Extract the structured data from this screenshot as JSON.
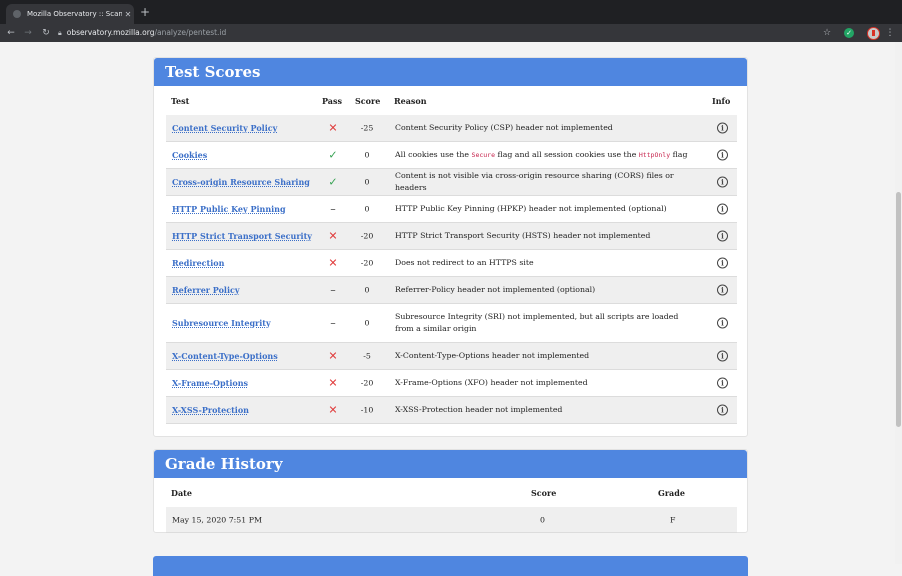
{
  "browser": {
    "tab_title": "Mozilla Observatory :: Scan Re",
    "tab_close": "✕",
    "new_tab": "+",
    "url_host": "observatory.mozilla.org",
    "url_path": "/analyze/pentest.id"
  },
  "test_scores": {
    "title": "Test Scores",
    "headers": {
      "test": "Test",
      "pass": "Pass",
      "score": "Score",
      "reason": "Reason",
      "info": "Info"
    },
    "rows": [
      {
        "name": "Content Security Policy",
        "pass": "fail",
        "score": "-25",
        "reason": "Content Security Policy (CSP) header not implemented"
      },
      {
        "name": "Cookies",
        "pass": "ok",
        "score": "0",
        "reason_parts": [
          "All cookies use the ",
          "Secure",
          " flag and all session cookies use the ",
          "HttpOnly",
          " flag"
        ]
      },
      {
        "name": "Cross-origin Resource Sharing",
        "pass": "ok",
        "score": "0",
        "reason": "Content is not visible via cross-origin resource sharing (CORS) files or headers"
      },
      {
        "name": "HTTP Public Key Pinning",
        "pass": "na",
        "score": "0",
        "reason": "HTTP Public Key Pinning (HPKP) header not implemented (optional)"
      },
      {
        "name": "HTTP Strict Transport Security",
        "pass": "fail",
        "score": "-20",
        "reason": "HTTP Strict Transport Security (HSTS) header not implemented"
      },
      {
        "name": "Redirection",
        "pass": "fail",
        "score": "-20",
        "reason": "Does not redirect to an HTTPS site"
      },
      {
        "name": "Referrer Policy",
        "pass": "na",
        "score": "0",
        "reason": "Referrer-Policy header not implemented (optional)"
      },
      {
        "name": "Subresource Integrity",
        "pass": "na",
        "score": "0",
        "reason": "Subresource Integrity (SRI) not implemented, but all scripts are loaded from a similar origin"
      },
      {
        "name": "X-Content-Type-Options",
        "pass": "fail",
        "score": "-5",
        "reason": "X-Content-Type-Options header not implemented"
      },
      {
        "name": "X-Frame-Options",
        "pass": "fail",
        "score": "-20",
        "reason": "X-Frame-Options (XFO) header not implemented"
      },
      {
        "name": "X-XSS-Protection",
        "pass": "fail",
        "score": "-10",
        "reason": "X-XSS-Protection header not implemented"
      }
    ]
  },
  "grade_history": {
    "title": "Grade History",
    "headers": {
      "date": "Date",
      "score": "Score",
      "grade": "Grade"
    },
    "rows": [
      {
        "date": "May 15, 2020 7:51 PM",
        "score": "0",
        "grade": "F"
      }
    ]
  },
  "icons": {
    "fail": "✕",
    "ok": "✓",
    "na": "–",
    "info": "i"
  },
  "colors": {
    "header_blue": "#4f86e0",
    "link_blue": "#3b6fc8",
    "fail_red": "#e03b3b",
    "pass_green": "#38a354"
  }
}
